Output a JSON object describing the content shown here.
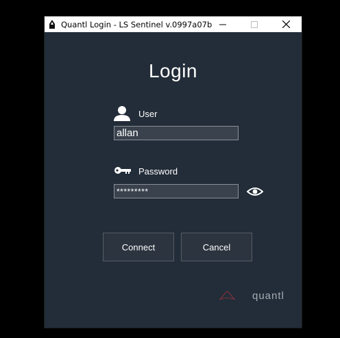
{
  "window": {
    "title": "Quantl Login - LS Sentinel v.0997a07b",
    "icons": {
      "app": "app-icon",
      "minimize": "minimize-icon",
      "maximize": "maximize-icon",
      "close": "close-icon"
    }
  },
  "login": {
    "heading": "Login",
    "user_label": "User",
    "user_value": "allan",
    "password_label": "Password",
    "password_value": "*********",
    "show_password_icon": "eye-icon",
    "connect_label": "Connect",
    "cancel_label": "Cancel"
  },
  "brand": {
    "name": "quantl",
    "accent": "#b0323c"
  },
  "colors": {
    "background": "#232d39",
    "field": "#39424d",
    "button": "#2c343f"
  }
}
